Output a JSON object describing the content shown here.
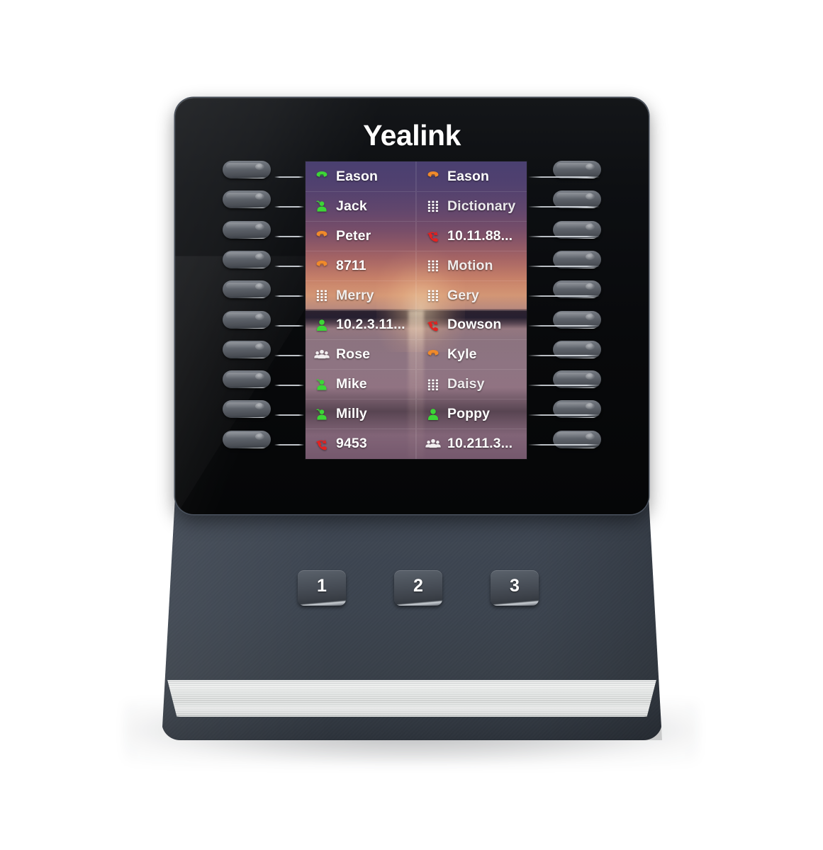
{
  "device": {
    "brand": "Yealink",
    "type": "lcd-expansion-module"
  },
  "screen": {
    "columns": [
      {
        "side": "left",
        "keys": [
          {
            "icon": "phone-handset-green-icon",
            "icon_color": "#3cd636",
            "label": "Eason",
            "state": "idle-green"
          },
          {
            "icon": "user-headset-green-icon",
            "icon_color": "#3cd636",
            "label": "Jack",
            "state": "idle-green"
          },
          {
            "icon": "phone-handset-orange-icon",
            "icon_color": "#f08a2a",
            "label": "Peter",
            "state": "ringing-orange"
          },
          {
            "icon": "phone-handset-orange-icon",
            "icon_color": "#f08a2a",
            "label": "8711",
            "state": "ringing-orange"
          },
          {
            "icon": "dialpad-white-icon",
            "icon_color": "#ffffff",
            "label": "Merry",
            "state": "dtmf-white"
          },
          {
            "icon": "user-green-icon",
            "icon_color": "#3cd636",
            "label": "10.2.3.11...",
            "state": "idle-green"
          },
          {
            "icon": "group-white-icon",
            "icon_color": "#f2eef0",
            "label": "Rose",
            "state": "group-white"
          },
          {
            "icon": "user-headset-green-icon",
            "icon_color": "#3cd636",
            "label": "Mike",
            "state": "idle-green"
          },
          {
            "icon": "user-headset-green-icon",
            "icon_color": "#3cd636",
            "label": "Milly",
            "state": "idle-green"
          },
          {
            "icon": "phone-incoming-red-icon",
            "icon_color": "#e8201f",
            "label": "9453",
            "state": "busy-red"
          }
        ]
      },
      {
        "side": "right",
        "keys": [
          {
            "icon": "phone-handset-orange-icon",
            "icon_color": "#f08a2a",
            "label": "Eason",
            "state": "ringing-orange"
          },
          {
            "icon": "dialpad-white-icon",
            "icon_color": "#ffffff",
            "label": "Dictionary",
            "state": "dtmf-white"
          },
          {
            "icon": "phone-incoming-red-icon",
            "icon_color": "#e8201f",
            "label": "10.11.88...",
            "state": "busy-red"
          },
          {
            "icon": "dialpad-white-icon",
            "icon_color": "#ffffff",
            "label": "Motion",
            "state": "dtmf-white"
          },
          {
            "icon": "dialpad-white-icon",
            "icon_color": "#ffffff",
            "label": "Gery",
            "state": "dtmf-white"
          },
          {
            "icon": "phone-incoming-red-icon",
            "icon_color": "#e8201f",
            "label": "Dowson",
            "state": "busy-red"
          },
          {
            "icon": "phone-handset-orange-icon",
            "icon_color": "#f08a2a",
            "label": "Kyle",
            "state": "ringing-orange"
          },
          {
            "icon": "dialpad-white-icon",
            "icon_color": "#ffffff",
            "label": "Daisy",
            "state": "dtmf-white"
          },
          {
            "icon": "user-green-icon",
            "icon_color": "#3cd636",
            "label": "Poppy",
            "state": "idle-green"
          },
          {
            "icon": "group-white-icon",
            "icon_color": "#f2eef0",
            "label": "10.211.3...",
            "state": "group-white"
          }
        ]
      }
    ]
  },
  "page_buttons": [
    {
      "label": "1",
      "name": "page-1"
    },
    {
      "label": "2",
      "name": "page-2"
    },
    {
      "label": "3",
      "name": "page-3"
    }
  ],
  "colors": {
    "status_green": "#3cd636",
    "status_orange": "#f08a2a",
    "status_red": "#e8201f",
    "status_white": "#ffffff",
    "bezel": "#0a0c0e",
    "body": "#3f4753",
    "text": "#ffffff"
  }
}
